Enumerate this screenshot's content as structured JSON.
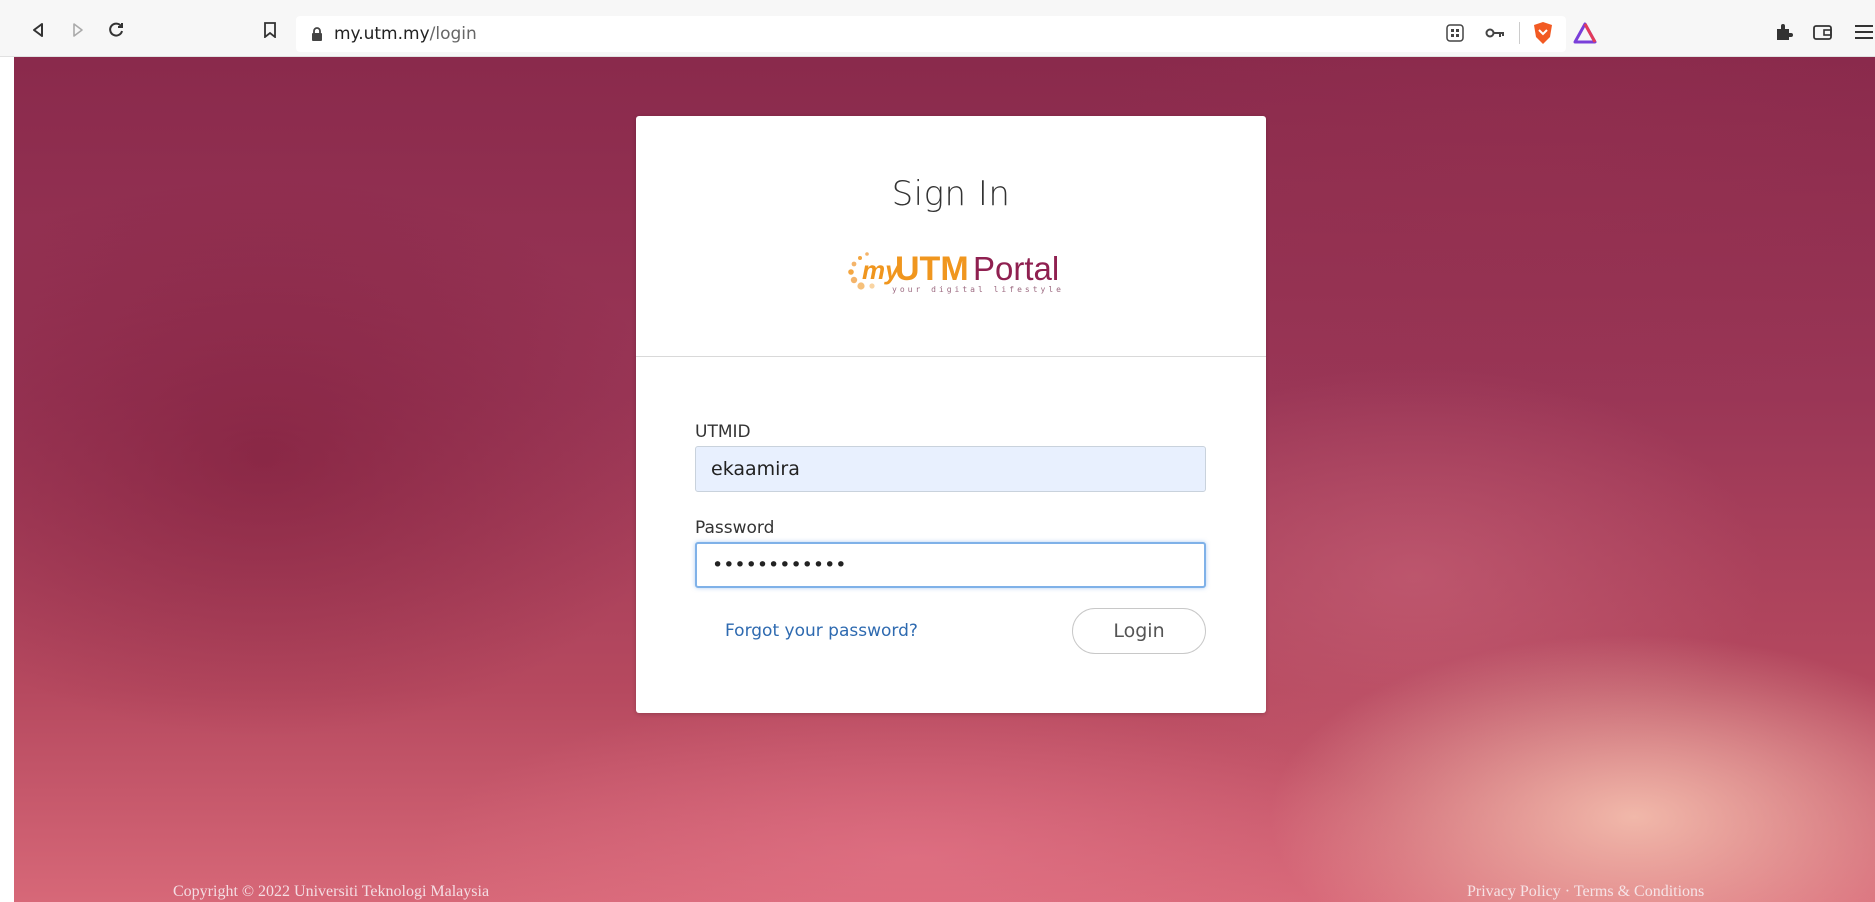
{
  "browser": {
    "url_host": "my.utm.my",
    "url_path": "/login"
  },
  "card": {
    "title": "Sign In",
    "logo": {
      "my": "my",
      "utm": "UTM",
      "portal": "Portal",
      "tagline": "your digital lifestyle"
    },
    "utmid_label": "UTMID",
    "utmid_value": "ekaamira",
    "password_label": "Password",
    "password_value": "••••••••••••",
    "forgot_link": "Forgot your password?",
    "login_button": "Login"
  },
  "footer": {
    "copyright": "Copyright © 2022 Universiti Teknologi Malaysia",
    "privacy": "Privacy Policy",
    "separator": "·",
    "terms": "Terms & Conditions"
  },
  "icons": [
    "back-icon",
    "forward-icon",
    "reload-icon",
    "bookmark-icon",
    "lock-icon",
    "qr-code-icon",
    "key-icon",
    "brave-shield-icon",
    "brave-rewards-icon",
    "extensions-icon",
    "wallet-icon",
    "menu-icon"
  ]
}
